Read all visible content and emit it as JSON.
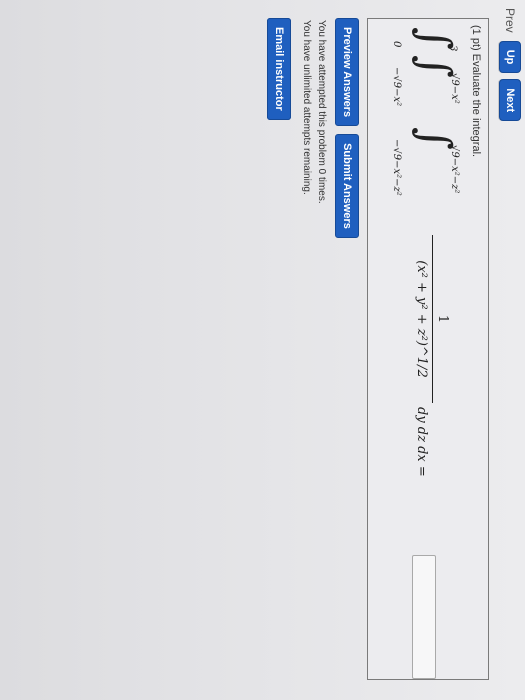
{
  "nav": {
    "prev": "Prev",
    "up": "Up",
    "next": "Next"
  },
  "problem": {
    "prompt": "(1 pt) Evaluate the integral.",
    "integrand_numerator": "1",
    "integrand_denominator": "(x² + y² + z²)^1/2",
    "differentials": "dy dz dx =",
    "limits": {
      "outer_lower": "0",
      "outer_upper": "3",
      "middle_lower": "−√9−x²",
      "middle_upper": "√9−x²",
      "inner_lower": "−√9−x²−z²",
      "inner_upper": "√9−x²−z²"
    },
    "answer_value": ""
  },
  "actions": {
    "preview": "Preview Answers",
    "submit": "Submit Answers"
  },
  "status": {
    "attempted": "You have attempted this problem 0 times.",
    "remaining": "You have unlimited attempts remaining."
  },
  "email": "Email instructor",
  "colors": {
    "button": "#1f5fbf",
    "background": "#e6e6e9"
  }
}
